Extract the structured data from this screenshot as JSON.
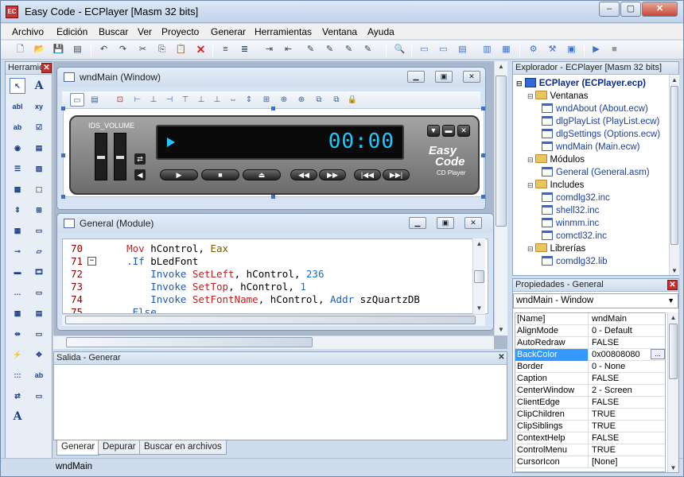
{
  "window": {
    "title": "Easy Code - ECPlayer [Masm 32 bits]",
    "app_icon": "EC"
  },
  "caption_buttons": {
    "minimize": "‒",
    "maximize": "▢",
    "close": "✕"
  },
  "menu": [
    "Archivo",
    "Edición",
    "Buscar",
    "Ver",
    "Proyecto",
    "Generar",
    "Herramientas",
    "Ventana",
    "Ayuda"
  ],
  "toolbar_icons": [
    "new-file-icon",
    "open-folder-icon",
    "save-icon",
    "save-all-icon",
    "undo-icon",
    "redo-icon",
    "cut-icon",
    "copy-icon",
    "paste-icon",
    "delete-icon",
    "indent-icon",
    "outdent-icon",
    "comment-icon",
    "uncomment-icon",
    "bookmark-icon",
    "bookmark-next-icon",
    "bookmark-prev-icon",
    "bookmark-clear-icon",
    "find-icon",
    "window-icon",
    "dialog-icon",
    "module-icon",
    "include-icon",
    "resource-icon",
    "properties-icon",
    "build-icon",
    "compile-icon",
    "run-icon",
    "stop-icon"
  ],
  "toolbox": {
    "title": "Herramientas",
    "close": "✕"
  },
  "wndmain": {
    "title": "wndMain (Window)"
  },
  "mdi_buttons": {
    "minimize": "▁",
    "restore": "▣",
    "close": "✕"
  },
  "player": {
    "volume_label": "IDS_VOLUME",
    "time": "00:00",
    "brand_line1": "Easy",
    "brand_line2": "Code",
    "brand_line3": "CD Player",
    "buttons": {
      "play": "▶",
      "stop": "■",
      "eject": "⏏",
      "rewind": "◀◀",
      "forward": "▶▶",
      "prev": "|◀◀",
      "next": "▶▶|"
    },
    "window_buttons": {
      "menu": "▼",
      "minimize": "▬",
      "close": "✕"
    }
  },
  "general": {
    "title": "General (Module)",
    "lines": [
      {
        "num": "70",
        "fold": "",
        "tokens": [
          {
            "t": "    ",
            "c": ""
          },
          {
            "t": "Mov",
            "c": "kw-red"
          },
          {
            "t": " hControl, ",
            "c": ""
          },
          {
            "t": "Eax",
            "c": "kw-green"
          }
        ]
      },
      {
        "num": "71",
        "fold": "−",
        "tokens": [
          {
            "t": "    ",
            "c": ""
          },
          {
            "t": ".If",
            "c": "kw-blue"
          },
          {
            "t": " bLedFont",
            "c": ""
          }
        ]
      },
      {
        "num": "72",
        "fold": "",
        "tokens": [
          {
            "t": "        ",
            "c": ""
          },
          {
            "t": "Invoke",
            "c": "kw-blue"
          },
          {
            "t": " ",
            "c": ""
          },
          {
            "t": "SetLeft",
            "c": "kw-red"
          },
          {
            "t": ", hControl, ",
            "c": ""
          },
          {
            "t": "236",
            "c": "kw-num"
          }
        ]
      },
      {
        "num": "73",
        "fold": "",
        "tokens": [
          {
            "t": "        ",
            "c": ""
          },
          {
            "t": "Invoke",
            "c": "kw-blue"
          },
          {
            "t": " ",
            "c": ""
          },
          {
            "t": "SetTop",
            "c": "kw-red"
          },
          {
            "t": ", hControl, ",
            "c": ""
          },
          {
            "t": "1",
            "c": "kw-num"
          }
        ]
      },
      {
        "num": "74",
        "fold": "",
        "tokens": [
          {
            "t": "        ",
            "c": ""
          },
          {
            "t": "Invoke",
            "c": "kw-blue"
          },
          {
            "t": " ",
            "c": ""
          },
          {
            "t": "SetFontName",
            "c": "kw-red"
          },
          {
            "t": ", hControl, ",
            "c": ""
          },
          {
            "t": "Addr",
            "c": "kw-blue"
          },
          {
            "t": " szQuartzDB",
            "c": ""
          }
        ]
      },
      {
        "num": "75",
        "fold": "",
        "tokens": [
          {
            "t": "    ",
            "c": ""
          },
          {
            "t": ".Else",
            "c": "kw-blue"
          }
        ]
      }
    ]
  },
  "output": {
    "title": "Salida - Generar",
    "close": "✕"
  },
  "tabs": [
    "Generar",
    "Depurar",
    "Buscar en archivos"
  ],
  "status": {
    "text": "wndMain"
  },
  "explorer": {
    "title": "Explorador - ECPlayer [Masm 32 bits]",
    "project": "ECPlayer (ECPlayer.ecp)",
    "tree": [
      {
        "label": "Ventanas",
        "kind": "folder",
        "indent": 1
      },
      {
        "label": "wndAbout (About.ecw)",
        "kind": "doc",
        "indent": 2
      },
      {
        "label": "dlgPlayList (PlayList.ecw)",
        "kind": "doc",
        "indent": 2
      },
      {
        "label": "dlgSettings (Options.ecw)",
        "kind": "doc",
        "indent": 2
      },
      {
        "label": "wndMain (Main.ecw)",
        "kind": "doc",
        "indent": 2
      },
      {
        "label": "Módulos",
        "kind": "folder",
        "indent": 1
      },
      {
        "label": "General (General.asm)",
        "kind": "doc",
        "indent": 2
      },
      {
        "label": "Includes",
        "kind": "folder",
        "indent": 1
      },
      {
        "label": "comdlg32.inc",
        "kind": "doc",
        "indent": 2
      },
      {
        "label": "shell32.inc",
        "kind": "doc",
        "indent": 2
      },
      {
        "label": "winmm.inc",
        "kind": "doc",
        "indent": 2
      },
      {
        "label": "comctl32.inc",
        "kind": "doc",
        "indent": 2
      },
      {
        "label": "Librerías",
        "kind": "folder",
        "indent": 1
      },
      {
        "label": "comdlg32.lib",
        "kind": "doc",
        "indent": 2
      }
    ]
  },
  "properties": {
    "title": "Propiedades - General",
    "close": "✕",
    "selector": "wndMain - Window",
    "selector_arrow": "▼",
    "rows": [
      {
        "name": "[Name]",
        "value": "wndMain"
      },
      {
        "name": "AlignMode",
        "value": "0 - Default"
      },
      {
        "name": "AutoRedraw",
        "value": "FALSE"
      },
      {
        "name": "BackColor",
        "value": "0x00808080"
      },
      {
        "name": "Border",
        "value": "0 - None"
      },
      {
        "name": "Caption",
        "value": "FALSE"
      },
      {
        "name": "CenterWindow",
        "value": "2 - Screen"
      },
      {
        "name": "ClientEdge",
        "value": "FALSE"
      },
      {
        "name": "ClipChildren",
        "value": "TRUE"
      },
      {
        "name": "ClipSiblings",
        "value": "TRUE"
      },
      {
        "name": "ContextHelp",
        "value": "FALSE"
      },
      {
        "name": "ControlMenu",
        "value": "TRUE"
      },
      {
        "name": "CursorIcon",
        "value": "[None]"
      }
    ],
    "selected": "BackColor",
    "ellipsis": "..."
  }
}
